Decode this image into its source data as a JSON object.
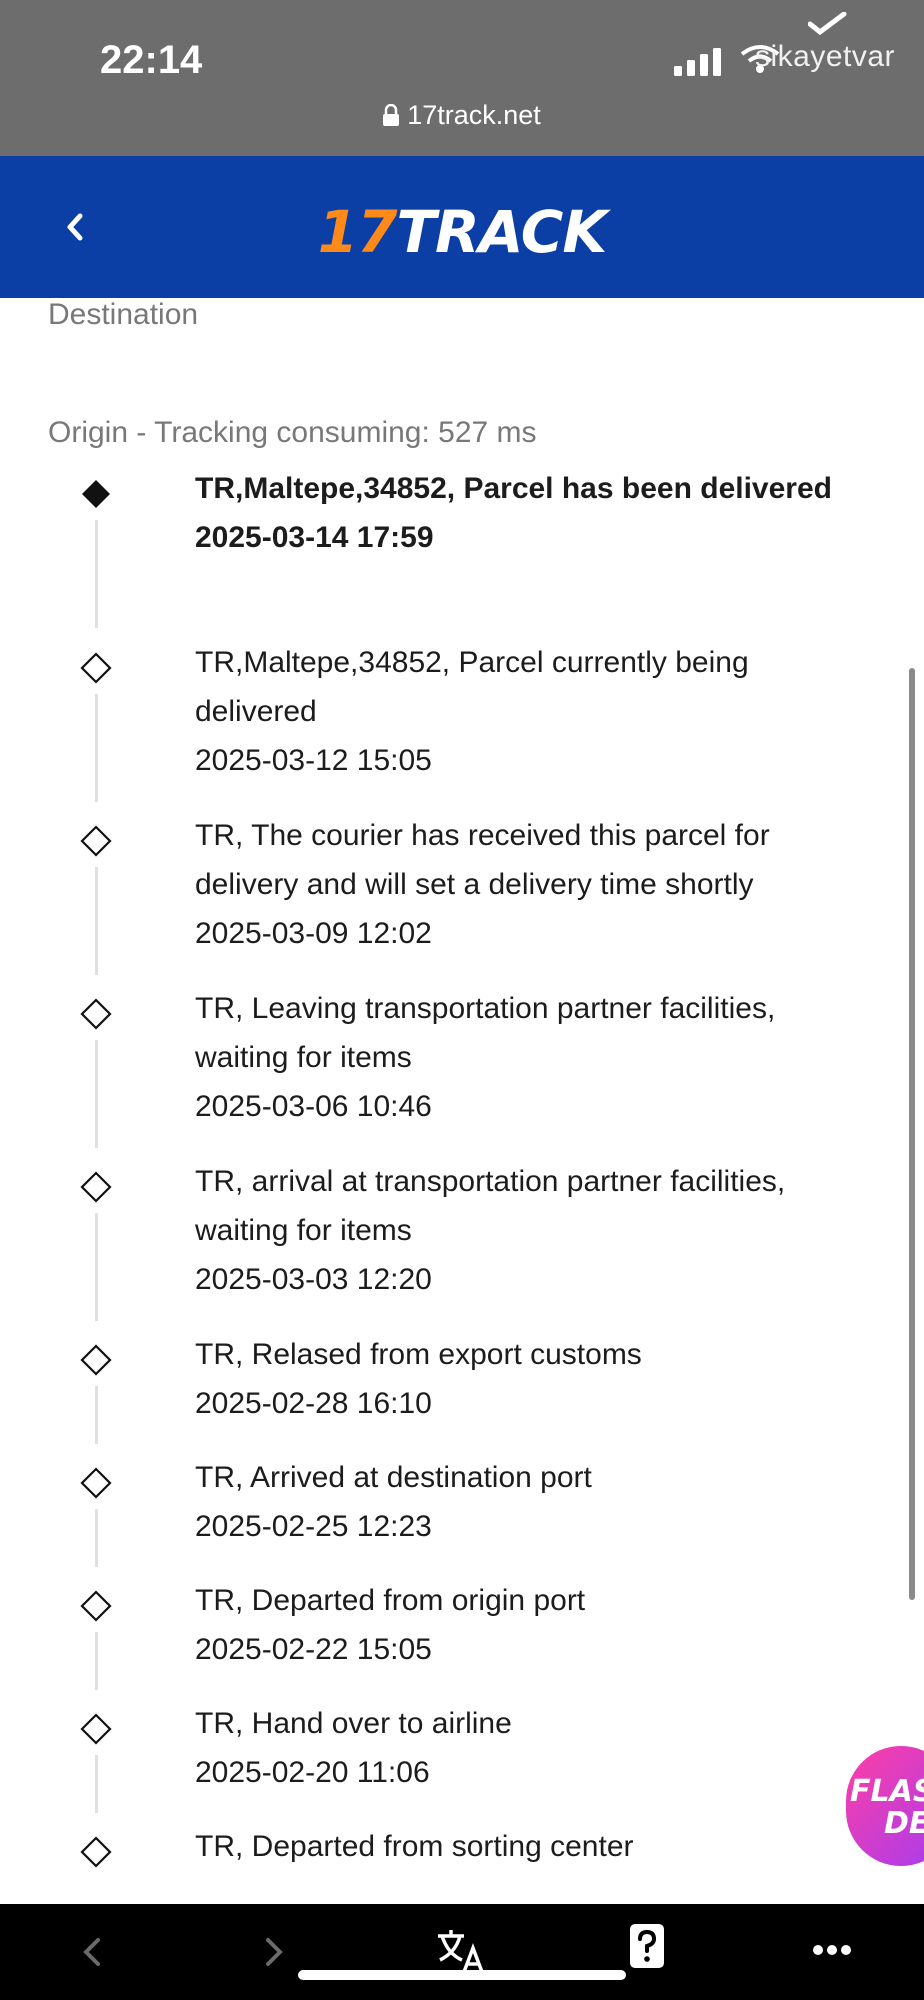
{
  "status_bar": {
    "time": "22:14",
    "carrier": "sikayetvar",
    "url": "17track.net"
  },
  "header": {
    "logo_number": "17",
    "logo_word": "TRACK"
  },
  "tracking": {
    "destination_label": "Destination",
    "origin_label": "Origin - Tracking consuming: 527 ms",
    "events": [
      {
        "description": "TR,Maltepe,34852, Parcel has been delivered",
        "timestamp": "2025-03-14 17:59",
        "current": true
      },
      {
        "description": "TR,Maltepe,34852, Parcel currently being delivered",
        "timestamp": "2025-03-12 15:05"
      },
      {
        "description": "TR, The courier has received this parcel for delivery and will set a delivery time shortly",
        "timestamp": "2025-03-09 12:02"
      },
      {
        "description": "TR, Leaving transportation partner facilities, waiting for items",
        "timestamp": "2025-03-06 10:46"
      },
      {
        "description": "TR, arrival at transportation partner facilities, waiting for items",
        "timestamp": "2025-03-03 12:20"
      },
      {
        "description": "TR, Relased from export customs",
        "timestamp": "2025-02-28 16:10"
      },
      {
        "description": "TR, Arrived at destination port",
        "timestamp": "2025-02-25 12:23"
      },
      {
        "description": "TR, Departed from origin port",
        "timestamp": "2025-02-22 15:05"
      },
      {
        "description": "TR, Hand over to airline",
        "timestamp": "2025-02-20 11:06"
      },
      {
        "description": "TR, Departed from sorting center",
        "timestamp": ""
      }
    ]
  },
  "promo": {
    "line1": "FLAS",
    "line2": "DE"
  },
  "bottom_bar": {
    "back_icon": "chevron-left-icon",
    "forward_icon": "chevron-right-icon",
    "translate_icon": "translate-icon",
    "help_icon": "help-icon",
    "more_icon": "more-icon"
  }
}
